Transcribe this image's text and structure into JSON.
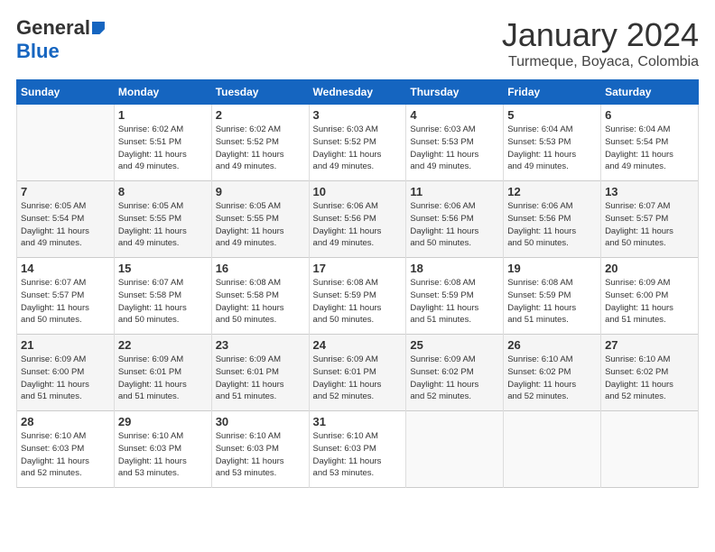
{
  "logo": {
    "general": "General",
    "blue": "Blue"
  },
  "title": "January 2024",
  "subtitle": "Turmeque, Boyaca, Colombia",
  "days_of_week": [
    "Sunday",
    "Monday",
    "Tuesday",
    "Wednesday",
    "Thursday",
    "Friday",
    "Saturday"
  ],
  "weeks": [
    [
      {
        "day": "",
        "info": ""
      },
      {
        "day": "1",
        "info": "Sunrise: 6:02 AM\nSunset: 5:51 PM\nDaylight: 11 hours\nand 49 minutes."
      },
      {
        "day": "2",
        "info": "Sunrise: 6:02 AM\nSunset: 5:52 PM\nDaylight: 11 hours\nand 49 minutes."
      },
      {
        "day": "3",
        "info": "Sunrise: 6:03 AM\nSunset: 5:52 PM\nDaylight: 11 hours\nand 49 minutes."
      },
      {
        "day": "4",
        "info": "Sunrise: 6:03 AM\nSunset: 5:53 PM\nDaylight: 11 hours\nand 49 minutes."
      },
      {
        "day": "5",
        "info": "Sunrise: 6:04 AM\nSunset: 5:53 PM\nDaylight: 11 hours\nand 49 minutes."
      },
      {
        "day": "6",
        "info": "Sunrise: 6:04 AM\nSunset: 5:54 PM\nDaylight: 11 hours\nand 49 minutes."
      }
    ],
    [
      {
        "day": "7",
        "info": "Sunrise: 6:05 AM\nSunset: 5:54 PM\nDaylight: 11 hours\nand 49 minutes."
      },
      {
        "day": "8",
        "info": "Sunrise: 6:05 AM\nSunset: 5:55 PM\nDaylight: 11 hours\nand 49 minutes."
      },
      {
        "day": "9",
        "info": "Sunrise: 6:05 AM\nSunset: 5:55 PM\nDaylight: 11 hours\nand 49 minutes."
      },
      {
        "day": "10",
        "info": "Sunrise: 6:06 AM\nSunset: 5:56 PM\nDaylight: 11 hours\nand 49 minutes."
      },
      {
        "day": "11",
        "info": "Sunrise: 6:06 AM\nSunset: 5:56 PM\nDaylight: 11 hours\nand 50 minutes."
      },
      {
        "day": "12",
        "info": "Sunrise: 6:06 AM\nSunset: 5:56 PM\nDaylight: 11 hours\nand 50 minutes."
      },
      {
        "day": "13",
        "info": "Sunrise: 6:07 AM\nSunset: 5:57 PM\nDaylight: 11 hours\nand 50 minutes."
      }
    ],
    [
      {
        "day": "14",
        "info": "Sunrise: 6:07 AM\nSunset: 5:57 PM\nDaylight: 11 hours\nand 50 minutes."
      },
      {
        "day": "15",
        "info": "Sunrise: 6:07 AM\nSunset: 5:58 PM\nDaylight: 11 hours\nand 50 minutes."
      },
      {
        "day": "16",
        "info": "Sunrise: 6:08 AM\nSunset: 5:58 PM\nDaylight: 11 hours\nand 50 minutes."
      },
      {
        "day": "17",
        "info": "Sunrise: 6:08 AM\nSunset: 5:59 PM\nDaylight: 11 hours\nand 50 minutes."
      },
      {
        "day": "18",
        "info": "Sunrise: 6:08 AM\nSunset: 5:59 PM\nDaylight: 11 hours\nand 51 minutes."
      },
      {
        "day": "19",
        "info": "Sunrise: 6:08 AM\nSunset: 5:59 PM\nDaylight: 11 hours\nand 51 minutes."
      },
      {
        "day": "20",
        "info": "Sunrise: 6:09 AM\nSunset: 6:00 PM\nDaylight: 11 hours\nand 51 minutes."
      }
    ],
    [
      {
        "day": "21",
        "info": "Sunrise: 6:09 AM\nSunset: 6:00 PM\nDaylight: 11 hours\nand 51 minutes."
      },
      {
        "day": "22",
        "info": "Sunrise: 6:09 AM\nSunset: 6:01 PM\nDaylight: 11 hours\nand 51 minutes."
      },
      {
        "day": "23",
        "info": "Sunrise: 6:09 AM\nSunset: 6:01 PM\nDaylight: 11 hours\nand 51 minutes."
      },
      {
        "day": "24",
        "info": "Sunrise: 6:09 AM\nSunset: 6:01 PM\nDaylight: 11 hours\nand 52 minutes."
      },
      {
        "day": "25",
        "info": "Sunrise: 6:09 AM\nSunset: 6:02 PM\nDaylight: 11 hours\nand 52 minutes."
      },
      {
        "day": "26",
        "info": "Sunrise: 6:10 AM\nSunset: 6:02 PM\nDaylight: 11 hours\nand 52 minutes."
      },
      {
        "day": "27",
        "info": "Sunrise: 6:10 AM\nSunset: 6:02 PM\nDaylight: 11 hours\nand 52 minutes."
      }
    ],
    [
      {
        "day": "28",
        "info": "Sunrise: 6:10 AM\nSunset: 6:03 PM\nDaylight: 11 hours\nand 52 minutes."
      },
      {
        "day": "29",
        "info": "Sunrise: 6:10 AM\nSunset: 6:03 PM\nDaylight: 11 hours\nand 53 minutes."
      },
      {
        "day": "30",
        "info": "Sunrise: 6:10 AM\nSunset: 6:03 PM\nDaylight: 11 hours\nand 53 minutes."
      },
      {
        "day": "31",
        "info": "Sunrise: 6:10 AM\nSunset: 6:03 PM\nDaylight: 11 hours\nand 53 minutes."
      },
      {
        "day": "",
        "info": ""
      },
      {
        "day": "",
        "info": ""
      },
      {
        "day": "",
        "info": ""
      }
    ]
  ]
}
